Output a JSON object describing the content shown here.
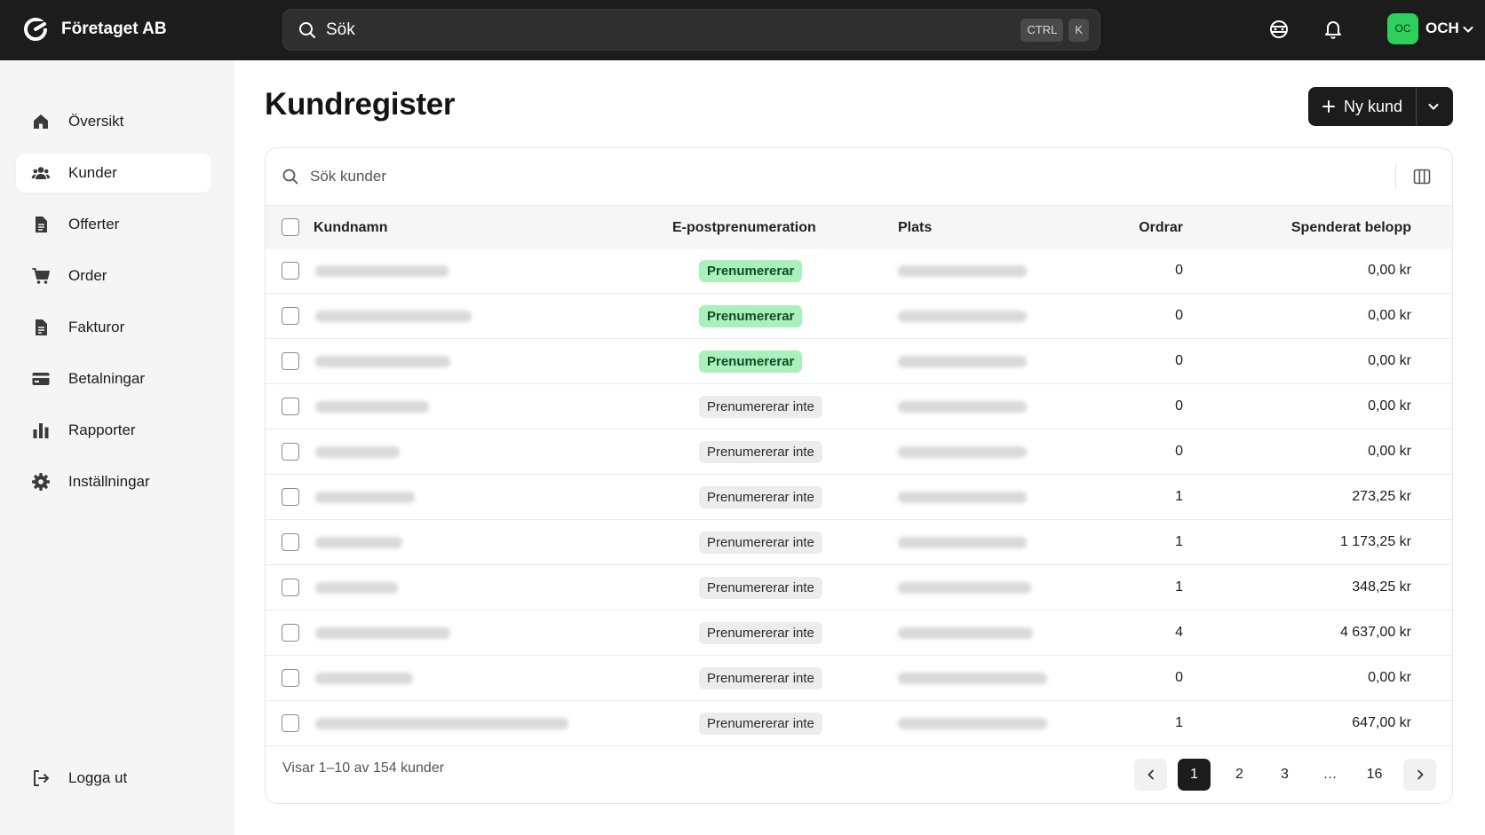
{
  "app": {
    "name": "Företaget AB"
  },
  "search": {
    "label": "Sök",
    "kbd": [
      "CTRL",
      "K"
    ]
  },
  "user": {
    "initials": "OC",
    "name": "OCH"
  },
  "sidebar": {
    "items": [
      {
        "label": "Översikt",
        "icon": "home-icon"
      },
      {
        "label": "Kunder",
        "icon": "users-icon",
        "active": true
      },
      {
        "label": "Offerter",
        "icon": "document-icon"
      },
      {
        "label": "Order",
        "icon": "cart-icon"
      },
      {
        "label": "Fakturor",
        "icon": "invoice-icon"
      },
      {
        "label": "Betalningar",
        "icon": "credit-card-icon"
      },
      {
        "label": "Rapporter",
        "icon": "bar-chart-icon"
      },
      {
        "label": "Inställningar",
        "icon": "gear-icon"
      }
    ],
    "logout": "Logga ut"
  },
  "page": {
    "title": "Kundregister",
    "new_button": "Ny kund"
  },
  "table": {
    "search_placeholder": "Sök kunder",
    "columns": [
      "Kundnamn",
      "E-postprenumeration",
      "Plats",
      "Ordrar",
      "Spenderat belopp"
    ],
    "rows": [
      {
        "subscription": "Prenumererar",
        "subscribed": true,
        "orders": "0",
        "amount": "0,00 kr"
      },
      {
        "subscription": "Prenumererar",
        "subscribed": true,
        "orders": "0",
        "amount": "0,00 kr"
      },
      {
        "subscription": "Prenumererar",
        "subscribed": true,
        "orders": "0",
        "amount": "0,00 kr"
      },
      {
        "subscription": "Prenumererar inte",
        "subscribed": false,
        "orders": "0",
        "amount": "0,00 kr"
      },
      {
        "subscription": "Prenumererar inte",
        "subscribed": false,
        "orders": "0",
        "amount": "0,00 kr"
      },
      {
        "subscription": "Prenumererar inte",
        "subscribed": false,
        "orders": "1",
        "amount": "273,25 kr"
      },
      {
        "subscription": "Prenumererar inte",
        "subscribed": false,
        "orders": "1",
        "amount": "1 173,25 kr"
      },
      {
        "subscription": "Prenumererar inte",
        "subscribed": false,
        "orders": "1",
        "amount": "348,25 kr"
      },
      {
        "subscription": "Prenumererar inte",
        "subscribed": false,
        "orders": "4",
        "amount": "4 637,00 kr"
      },
      {
        "subscription": "Prenumererar inte",
        "subscribed": false,
        "orders": "0",
        "amount": "0,00 kr"
      },
      {
        "subscription": "Prenumererar inte",
        "subscribed": false,
        "orders": "1",
        "amount": "647,00 kr"
      }
    ],
    "footer": "Visar 1–10 av 154 kunder"
  },
  "pagination": {
    "pages": [
      "1",
      "2",
      "3",
      "…",
      "16"
    ],
    "current": "1"
  }
}
